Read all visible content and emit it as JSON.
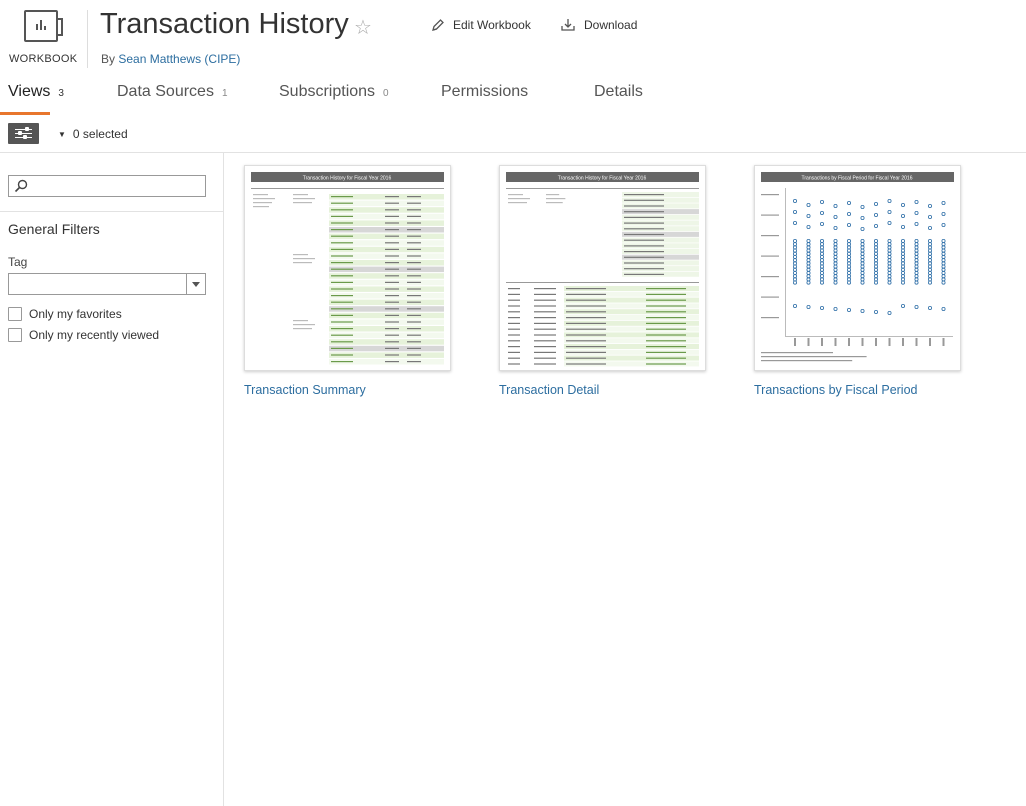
{
  "header": {
    "workbook_label": "WORKBOOK",
    "title": "Transaction History",
    "by_prefix": "By",
    "owner": "Sean Matthews (CIPE)",
    "edit_label": "Edit Workbook",
    "download_label": "Download"
  },
  "tabs": [
    {
      "label": "Views",
      "count": "3",
      "active": true
    },
    {
      "label": "Data Sources",
      "count": "1",
      "active": false
    },
    {
      "label": "Subscriptions",
      "count": "0",
      "active": false
    },
    {
      "label": "Permissions",
      "count": "",
      "active": false
    },
    {
      "label": "Details",
      "count": "",
      "active": false
    }
  ],
  "toolbar": {
    "selected_text": "0 selected"
  },
  "sidebar": {
    "search_placeholder": "",
    "general_filters": "General Filters",
    "tag_label": "Tag",
    "tag_value": "",
    "only_favorites": "Only my favorites",
    "only_recent": "Only my recently viewed"
  },
  "views": [
    {
      "title": "Transaction Summary",
      "thumb_heading": "Transaction History for Fiscal Year 2016"
    },
    {
      "title": "Transaction Detail",
      "thumb_heading": "Transaction History for Fiscal Year 2016"
    },
    {
      "title": "Transactions by Fiscal Period",
      "thumb_heading": "Transactions by Fiscal Period for Fiscal Year 2016"
    }
  ],
  "colors": {
    "accent": "#e8762d",
    "link": "#2d6ea0",
    "dot": "#2f6fa8"
  },
  "icons": {
    "workbook": "workbook-icon",
    "star": "star-icon",
    "edit": "pencil-icon",
    "download": "download-icon",
    "filter": "filter-sliders-icon",
    "search": "search-icon"
  }
}
